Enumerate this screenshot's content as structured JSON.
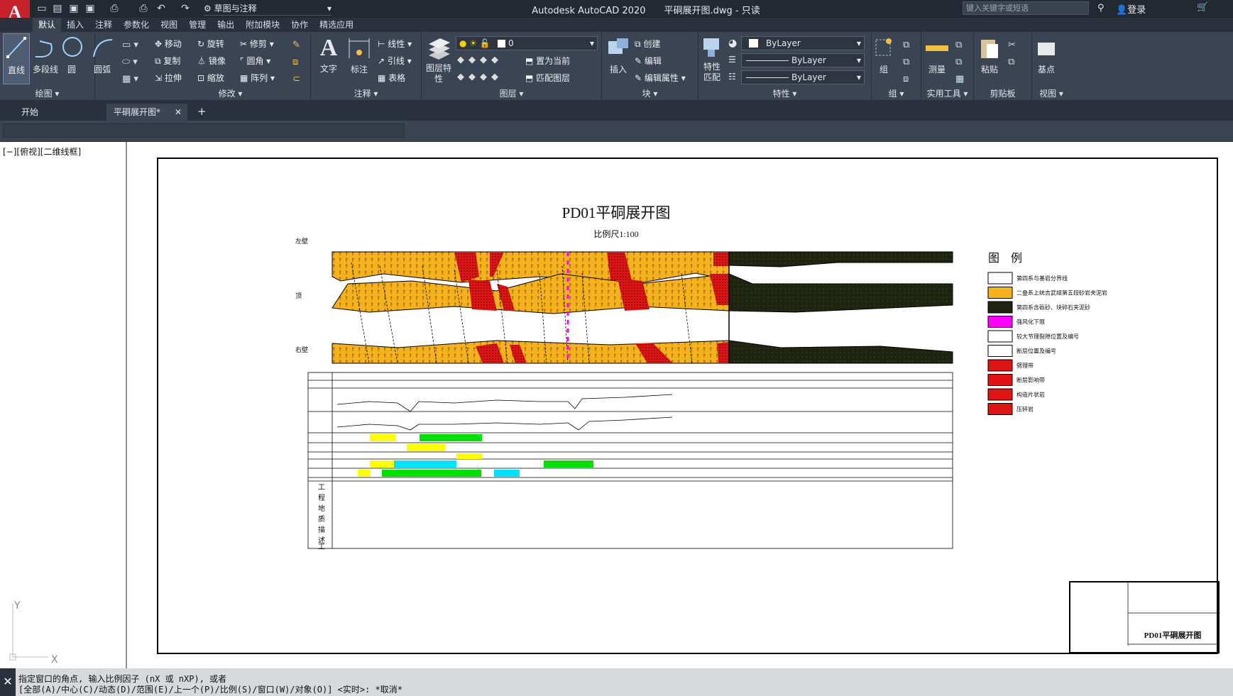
{
  "app": {
    "title": "Autodesk AutoCAD 2020",
    "file": "平硐展开图.dwg - 只读",
    "workspace": "草图与注释",
    "search_placeholder": "键入关键字或短语",
    "login": "登录",
    "logo": "A"
  },
  "ribbon_tabs": [
    "默认",
    "插入",
    "注释",
    "参数化",
    "视图",
    "管理",
    "输出",
    "附加模块",
    "协作",
    "精选应用"
  ],
  "draw": {
    "title": "绘图",
    "line": "直线",
    "polyline": "多段线",
    "circle": "圆",
    "arc": "圆弧"
  },
  "modify": {
    "title": "修改",
    "move": "移动",
    "rotate": "旋转",
    "trim": "修剪",
    "copy": "复制",
    "mirror": "镜像",
    "fillet": "圆角",
    "stretch": "拉伸",
    "scale": "缩放",
    "array": "阵列"
  },
  "annotation": {
    "title": "注释",
    "text": "文字",
    "dim": "标注",
    "linear": "线性",
    "leader": "引线",
    "table": "表格"
  },
  "layers": {
    "title": "图层",
    "props": "图层特性",
    "current_layer": "0",
    "make_current": "置为当前",
    "match": "匹配图层"
  },
  "block": {
    "title": "块",
    "insert": "插入",
    "create": "创建",
    "edit": "编辑",
    "edit_attr": "编辑属性"
  },
  "properties": {
    "title": "特性",
    "match": "特性匹配",
    "color": "ByLayer",
    "linetype": "ByLayer",
    "lineweight": "ByLayer"
  },
  "groups": {
    "title": "组",
    "group": "组"
  },
  "utilities": {
    "title": "实用工具",
    "measure": "测量"
  },
  "clipboard": {
    "title": "剪贴板",
    "paste": "粘贴"
  },
  "view": {
    "title": "视图",
    "base": "基点"
  },
  "doc_tabs": [
    {
      "label": "开始"
    },
    {
      "label": "平硐展开图*"
    }
  ],
  "viewport_label": "[−][俯视][二维线框]",
  "drawing": {
    "title": "PD01平硐展开图",
    "scale": "比例尺1:100",
    "left_wall": "左壁",
    "top": "顶",
    "right_wall": "右壁",
    "legend_title": "图　例",
    "titleblock_name": "PD01平硐展开图",
    "desc_label": [
      "工",
      "程",
      "地",
      "质",
      "描",
      "述"
    ]
  },
  "legend": [
    {
      "label": "第四系与基岩分界线",
      "color": "#ffffff"
    },
    {
      "label": "二叠系上统吉武组第五段砂岩夹泥岩",
      "color": "#f5b21c"
    },
    {
      "label": "第四系含砾砂、块碎石夹泥砂",
      "color": "#1e2410"
    },
    {
      "label": "强风化下限",
      "color": "#ff00ff"
    },
    {
      "label": "较大节理裂隙位置及编号",
      "color": "#ffffff"
    },
    {
      "label": "断层位置及编号",
      "color": "#ffffff"
    },
    {
      "label": "劈理带",
      "color": "#e01414"
    },
    {
      "label": "断层影响带",
      "color": "#e01414"
    },
    {
      "label": "构造片状岩",
      "color": "#e01414"
    },
    {
      "label": "压碎岩",
      "color": "#e01414"
    }
  ],
  "cmd": {
    "line1": "指定窗口的角点, 输入比例因子 (nX 或 nXP), 或者",
    "line2": "[全部(A)/中心(C)/动态(D)/范围(E)/上一个(P)/比例(S)/窗口(W)/对象(O)] <实时>: *取消*"
  },
  "ucs": {
    "x": "X",
    "y": "Y"
  }
}
